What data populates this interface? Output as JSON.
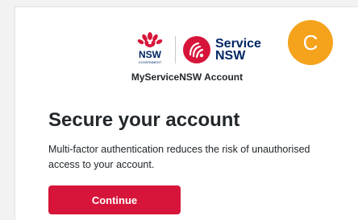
{
  "header": {
    "nsw_logo_text": "NSW",
    "nsw_logo_subtext": "GOVERNMENT",
    "service_logo_line1": "Service",
    "service_logo_line2": "NSW",
    "account_title": "MyServiceNSW Account"
  },
  "avatar": {
    "initial": "C",
    "color": "#f5a31c"
  },
  "main": {
    "title": "Secure your account",
    "description": "Multi-factor authentication reduces the risk of unauthorised access to your account.",
    "continue_label": "Continue"
  },
  "colors": {
    "brand_red": "#d7153a",
    "brand_navy": "#002664"
  }
}
